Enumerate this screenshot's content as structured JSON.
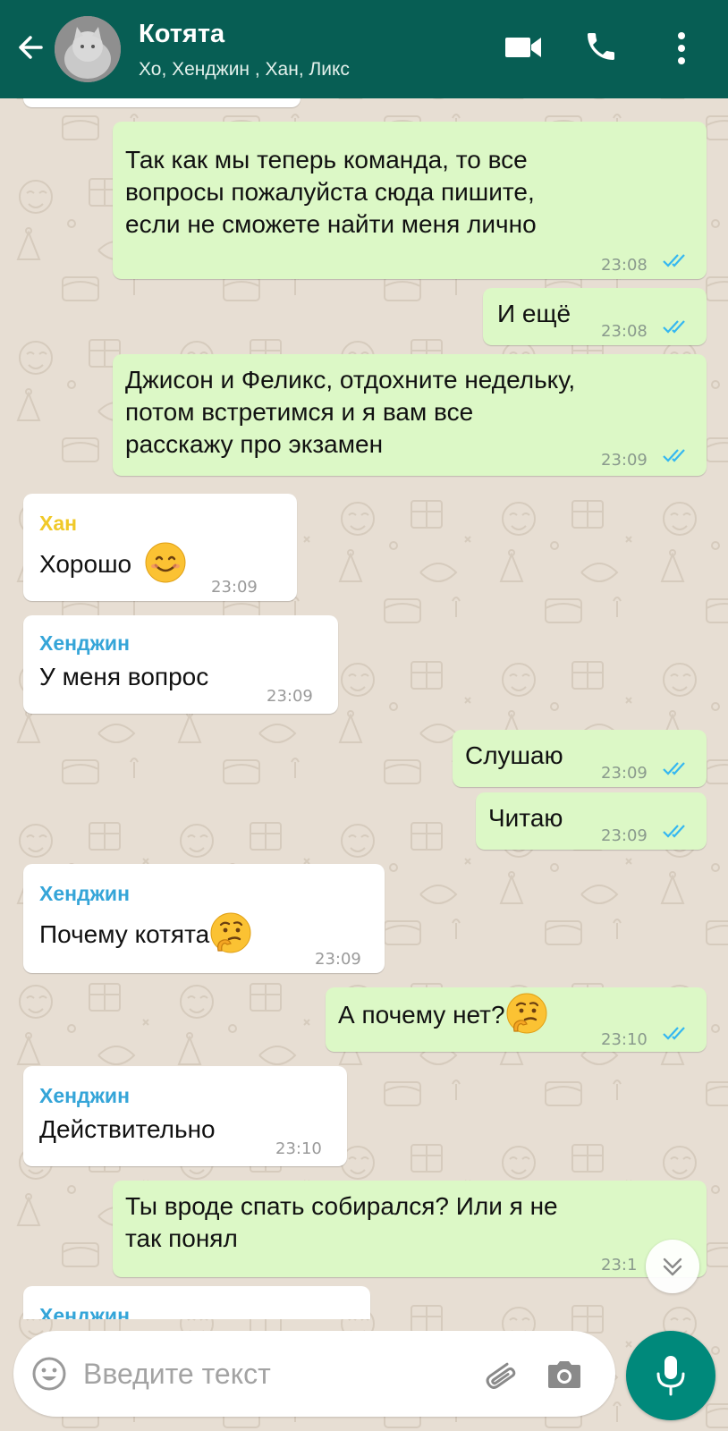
{
  "header": {
    "title": "Котята",
    "subtitle": "Хо, Хенджин , Хан, Ликс"
  },
  "colors": {
    "header_bg": "#075e54",
    "outgoing_bubble": "#dcf8c6",
    "incoming_bubble": "#ffffff",
    "read_ticks": "#34b7f1",
    "mic_button": "#00897b",
    "sender_han": "#f0c929",
    "sender_hyunjin": "#35a5d8"
  },
  "messages": [
    {
      "text1": "Так как мы теперь команда, то все",
      "text2": "вопросы пожалуйста сюда пишите,",
      "text3": "если не сможете найти меня лично",
      "time": "23:08"
    },
    {
      "text": "И ещё",
      "time": "23:08"
    },
    {
      "text1": "Джисон и Феликс, отдохните недельку,",
      "text2": "потом встретимся и я вам все",
      "text3": "расскажу про экзамен",
      "time": "23:09"
    },
    {
      "sender": "Хан",
      "text": "Хорошо",
      "emoji": "smiling-face",
      "time": "23:09"
    },
    {
      "sender": "Хенджин",
      "text": "У меня вопрос",
      "time": "23:09"
    },
    {
      "text": "Слушаю",
      "time": "23:09"
    },
    {
      "text": "Читаю",
      "time": "23:09"
    },
    {
      "sender": "Хенджин",
      "text": "Почему котята",
      "emoji": "thinking-face",
      "time": "23:09"
    },
    {
      "text": "А почему нет?",
      "emoji": "thinking-face",
      "time": "23:10"
    },
    {
      "sender": "Хенджин",
      "text": "Действительно",
      "time": "23:10"
    },
    {
      "text1": "Ты вроде спать собирался? Или я не",
      "text2": "так понял",
      "time": "23:1"
    },
    {
      "sender": "Хенджин"
    }
  ],
  "input": {
    "placeholder": "Введите текст"
  },
  "icons": {
    "back": "back-arrow-icon",
    "video": "video-call-icon",
    "call": "phone-icon",
    "menu": "more-vert-icon",
    "emoji": "emoji-icon",
    "attach": "paperclip-icon",
    "camera": "camera-icon",
    "mic": "mic-icon",
    "scroll": "double-chevron-down-icon"
  }
}
